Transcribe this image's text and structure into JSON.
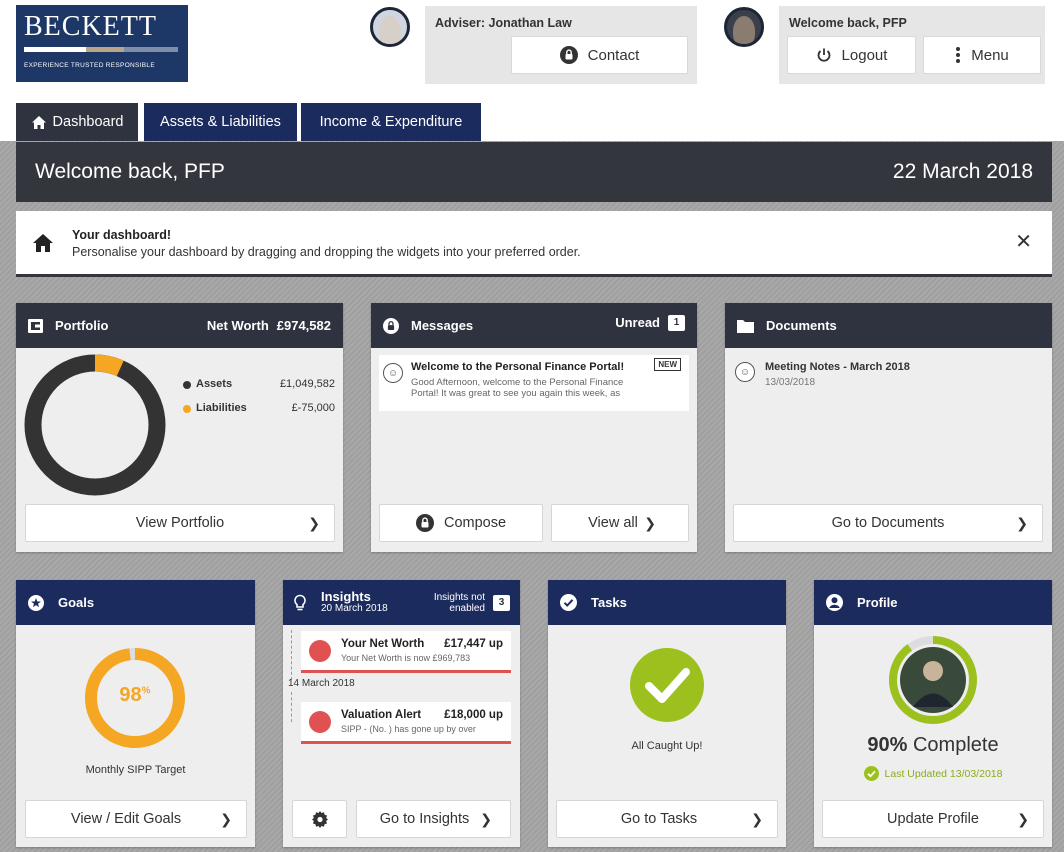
{
  "logo": {
    "brand": "BECKETT",
    "tagline": "EXPERIENCE   TRUSTED   RESPONSIBLE"
  },
  "adviser": {
    "label": "Adviser: Jonathan Law",
    "contact": "Contact"
  },
  "user": {
    "welcome": "Welcome back, PFP",
    "logout": "Logout",
    "menu": "Menu"
  },
  "tabs": [
    {
      "label": "Dashboard"
    },
    {
      "label": "Assets & Liabilities"
    },
    {
      "label": "Income & Expenditure"
    }
  ],
  "welcome_bar": {
    "title": "Welcome back, PFP",
    "date": "22 March 2018"
  },
  "notice": {
    "title": "Your dashboard!",
    "text": "Personalise your dashboard by dragging and dropping the widgets into your preferred order."
  },
  "portfolio": {
    "title": "Portfolio",
    "net_worth_label": "Net Worth",
    "net_worth": "£974,582",
    "assets_label": "Assets",
    "assets": "£1,049,582",
    "liabilities_label": "Liabilities",
    "liabilities": "£-75,000",
    "button": "View Portfolio",
    "colors": {
      "assets": "#333333",
      "liabilities": "#f5a623"
    },
    "assets_value": 1049582,
    "liabilities_value": 75000
  },
  "messages": {
    "title": "Messages",
    "unread_label": "Unread",
    "unread_count": "1",
    "item_title": "Welcome to the Personal Finance Portal!",
    "item_badge": "NEW",
    "item_line1": "Good Afternoon, welcome to the Personal Finance",
    "item_line2": "Portal! It was great to see you again this week, as",
    "compose": "Compose",
    "view_all": "View all"
  },
  "documents": {
    "title": "Documents",
    "item_title": "Meeting Notes - March 2018",
    "item_date": "13/03/2018",
    "button": "Go to Documents"
  },
  "goals": {
    "title": "Goals",
    "percent": "98",
    "percent_symbol": "%",
    "progress": 0.98,
    "caption": "Monthly SIPP Target",
    "button": "View / Edit Goals"
  },
  "insights": {
    "title": "Insights",
    "date": "20 March 2018",
    "status_line1": "Insights not",
    "status_line2": "enabled",
    "count": "3",
    "items": [
      {
        "title": "Your Net Worth",
        "value": "£17,447 up",
        "sub": "Your Net Worth is now £969,783"
      },
      {
        "title": "Valuation Alert",
        "value": "£18,000 up",
        "sub": "SIPP - (No. ) has gone up by over"
      }
    ],
    "group_date": "14 March 2018",
    "button": "Go to Insights"
  },
  "tasks": {
    "title": "Tasks",
    "status": "All Caught Up!",
    "button": "Go to Tasks"
  },
  "profile": {
    "title": "Profile",
    "percent": "90%",
    "complete_label": "Complete",
    "progress": 0.9,
    "last_updated": "Last Updated 13/03/2018",
    "button": "Update Profile"
  }
}
